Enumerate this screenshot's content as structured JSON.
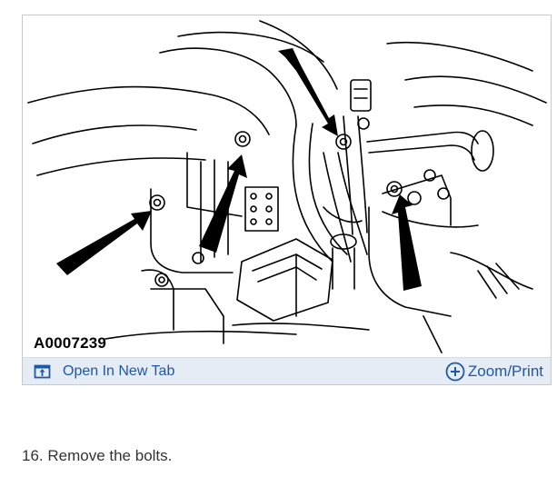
{
  "figure": {
    "caption_id": "A0007239",
    "open_tab_label": "Open In New Tab",
    "open_tab_icon": "open-in-new-tab-icon",
    "zoom_label": "Zoom/Print",
    "zoom_icon": "plus-circle-icon",
    "link_color": "#1f57a7",
    "bar_color": "#e6ecf5"
  },
  "step": {
    "text": "16. Remove the bolts."
  }
}
